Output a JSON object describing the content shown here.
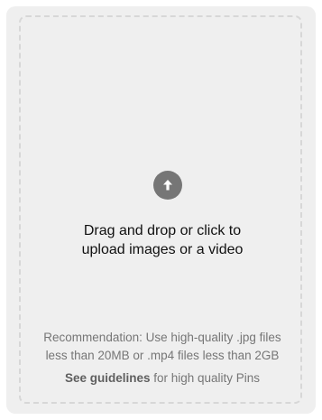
{
  "upload": {
    "icon": "arrow-up-circle-icon",
    "prompt_line1": "Drag and drop or click to",
    "prompt_line2": "upload images or a video",
    "recommendation_line1": "Recommendation: Use high-quality .jpg files",
    "recommendation_line2": "less than 20MB or .mp4 files less than 2GB",
    "guidelines_link": "See guidelines",
    "guidelines_suffix": " for high quality Pins"
  },
  "colors": {
    "card_background": "#efefef",
    "dashed_border": "#d7d7d7",
    "icon_background": "#767676",
    "primary_text": "#111111",
    "secondary_text": "#767676"
  }
}
